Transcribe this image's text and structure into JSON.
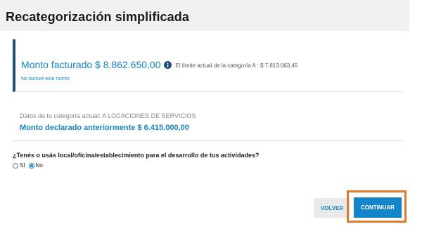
{
  "page": {
    "title": "Recategorización simplificada"
  },
  "billing": {
    "amount_label": "Monto facturado $ 8.862.650,00",
    "limit_text": "El límite actual de la categoría A : $ 7.813.063,45",
    "not_billed_link": "No facturé este monto",
    "info_icon": "info-circle-icon"
  },
  "category": {
    "current_category": "Datos de tu categoría actual: A LOCACIONES DE SERVICIOS",
    "declared_amount": "Monto declarado anteriormente $ 6.415.000,00"
  },
  "question": {
    "text": "¿Tenés o usás local/oficina/establecimiento para el desarrollo de tus actividades?",
    "options": [
      {
        "label": "SI",
        "selected": false
      },
      {
        "label": "No",
        "selected": true
      }
    ]
  },
  "actions": {
    "back_label": "VOLVER",
    "continue_label": "CONTINUAR"
  },
  "colors": {
    "accent": "#1485c8",
    "card_border": "#1f4e79",
    "highlight": "#e07b2d"
  }
}
